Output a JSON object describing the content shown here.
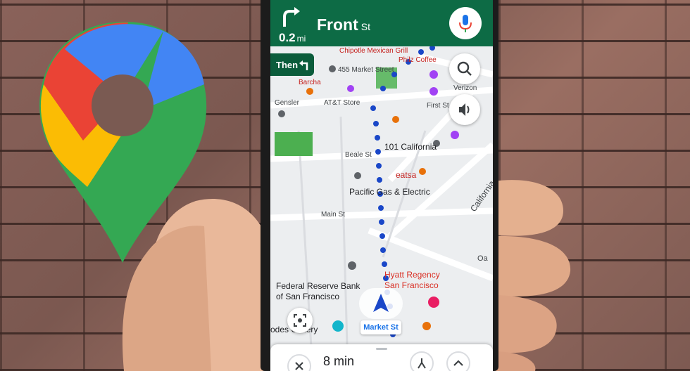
{
  "navigation": {
    "distance_value": "0.2",
    "distance_unit": "mi",
    "street_name": "Front",
    "street_suffix": "St",
    "then_label": "Then"
  },
  "map_labels": {
    "chipotle": "Chipotle Mexican Grill",
    "market_455": "455 Market Street",
    "philz": "Philz Coffee",
    "barcha": "Barcha",
    "verizon": "Verizon",
    "gensler": "Gensler",
    "att": "AT&T Store",
    "first_st": "First St",
    "california_101": "101 California",
    "beale": "Beale St",
    "eatsa": "eatsa",
    "pge": "Pacific Gas & Electric",
    "california": "California",
    "main": "Main St",
    "hyatt": "Hyatt Regency San Francisco",
    "fed": "Federal Reserve Bank of San Francisco",
    "gallery": "odes Gallery",
    "oa": "Oa",
    "market_st": "Market St"
  },
  "bottom_panel": {
    "eta": "8 min"
  },
  "colors": {
    "nav_green": "#0d6b45",
    "route_blue": "#1a47c8",
    "park_green": "#4caf50"
  }
}
